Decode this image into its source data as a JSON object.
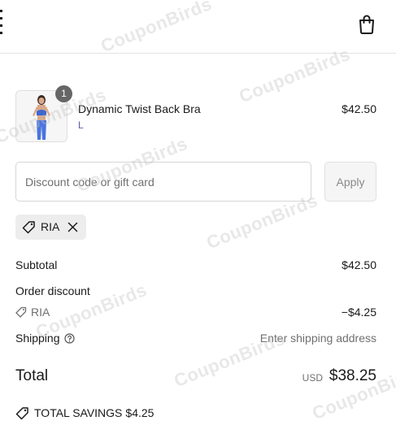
{
  "item": {
    "name": "Dynamic Twist Back Bra",
    "variant": "L",
    "price": "$42.50",
    "quantity": "1"
  },
  "discount": {
    "placeholder": "Discount code or gift card",
    "apply_label": "Apply",
    "applied_code": "RIA"
  },
  "totals": {
    "subtotal_label": "Subtotal",
    "subtotal_value": "$42.50",
    "order_discount_label": "Order discount",
    "discount_code": "RIA",
    "discount_value": "−$4.25",
    "shipping_label": "Shipping",
    "shipping_value": "Enter shipping address",
    "total_label": "Total",
    "total_currency": "USD",
    "total_value": "$38.25",
    "savings_label": "TOTAL SAVINGS",
    "savings_value": "$4.25"
  },
  "watermark": {
    "text": "CouponBirds"
  },
  "icons": {
    "menu": "menu-dots-icon",
    "bag": "shopping-bag-icon",
    "tag": "discount-tag-icon",
    "close": "close-icon",
    "info": "question-circle-icon"
  },
  "colors": {
    "variant": "#5a5aa6",
    "badge": "#666666",
    "tag_bg": "#ededed"
  }
}
